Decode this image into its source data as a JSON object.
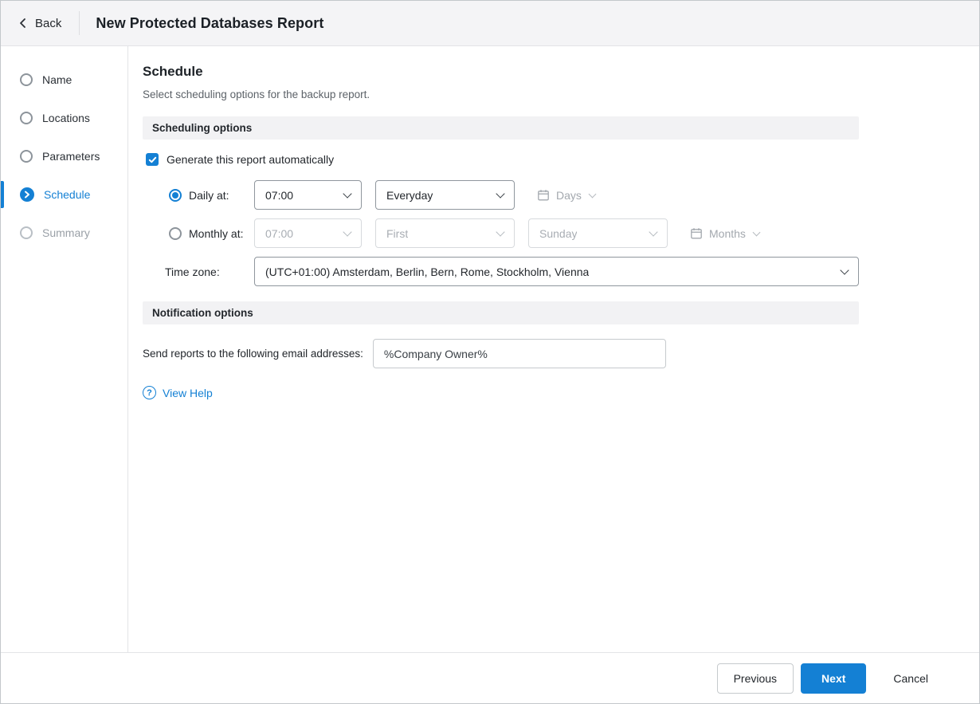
{
  "header": {
    "back_label": "Back",
    "title": "New Protected Databases Report"
  },
  "sidebar": {
    "steps": [
      {
        "label": "Name",
        "state": "pending"
      },
      {
        "label": "Locations",
        "state": "pending"
      },
      {
        "label": "Parameters",
        "state": "pending"
      },
      {
        "label": "Schedule",
        "state": "active"
      },
      {
        "label": "Summary",
        "state": "disabled"
      }
    ]
  },
  "main": {
    "title": "Schedule",
    "subtitle": "Select scheduling options for the backup report.",
    "scheduling_section": {
      "header": "Scheduling options",
      "auto_generate_label": "Generate this report automatically",
      "auto_generate_checked": true,
      "daily": {
        "label": "Daily at:",
        "selected": true,
        "time_value": "07:00",
        "frequency_value": "Everyday",
        "period_label": "Days"
      },
      "monthly": {
        "label": "Monthly at:",
        "selected": false,
        "time_value": "07:00",
        "week_value": "First",
        "weekday_value": "Sunday",
        "period_label": "Months"
      },
      "timezone": {
        "label": "Time zone:",
        "value": "(UTC+01:00) Amsterdam, Berlin, Bern, Rome, Stockholm, Vienna"
      }
    },
    "notification_section": {
      "header": "Notification options",
      "email_label": "Send reports to the following email addresses:",
      "email_value": "%Company Owner%",
      "help_link": "View Help"
    }
  },
  "footer": {
    "previous_label": "Previous",
    "next_label": "Next",
    "cancel_label": "Cancel"
  },
  "colors": {
    "accent": "#1480d4",
    "section_header_bg": "#f2f2f4",
    "topbar_bg": "#f4f4f6"
  }
}
